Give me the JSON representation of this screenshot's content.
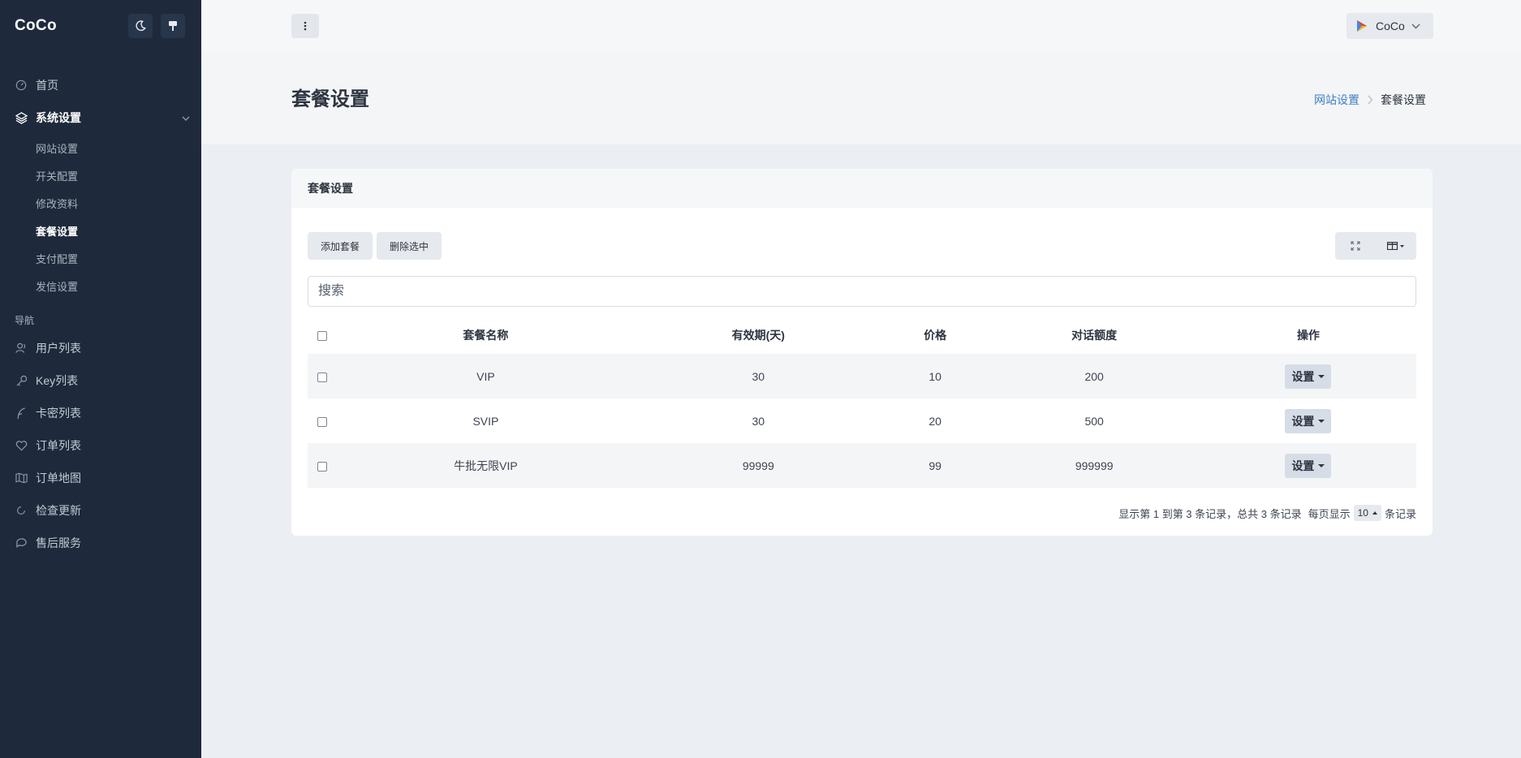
{
  "brand": {
    "name": "CoCo"
  },
  "sidebar": {
    "home": "首页",
    "system_group": "系统设置",
    "sub_items": [
      "网站设置",
      "开关配置",
      "修改资料",
      "套餐设置",
      "支付配置",
      "发信设置"
    ],
    "current_sub": "套餐设置",
    "nav_header": "导航",
    "nav_items": [
      "用户列表",
      "Key列表",
      "卡密列表",
      "订单列表",
      "订单地图",
      "检查更新",
      "售后服务"
    ]
  },
  "topbar": {
    "user_name": "CoCo"
  },
  "page": {
    "title": "套餐设置",
    "breadcrumb_parent": "网站设置",
    "breadcrumb_current": "套餐设置"
  },
  "card": {
    "title": "套餐设置",
    "add_button": "添加套餐",
    "delete_button": "删除选中",
    "search_placeholder": "搜索"
  },
  "table": {
    "headers": [
      "套餐名称",
      "有效期(天)",
      "价格",
      "对话额度",
      "操作"
    ],
    "rows": [
      {
        "name": "VIP",
        "days": "30",
        "price": "10",
        "quota": "200",
        "action": "设置"
      },
      {
        "name": "SVIP",
        "days": "30",
        "price": "20",
        "quota": "500",
        "action": "设置"
      },
      {
        "name": "牛批无限VIP",
        "days": "99999",
        "price": "99",
        "quota": "999999",
        "action": "设置"
      }
    ]
  },
  "pagination": {
    "summary": "显示第 1 到第 3 条记录，总共 3 条记录",
    "per_page_prefix": "每页显示",
    "page_size": "10",
    "per_page_suffix": "条记录"
  },
  "colors": {
    "sidebar_bg": "#1e2a3b",
    "accent_link": "#3f7ec4",
    "page_bg": "#ebeef3"
  }
}
